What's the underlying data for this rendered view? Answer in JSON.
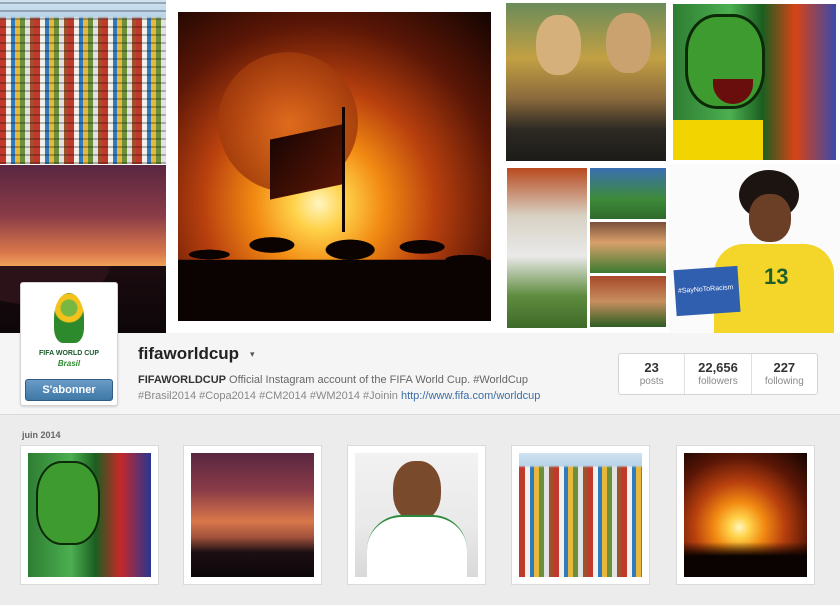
{
  "profile": {
    "username": "fifaworldcup",
    "caret": "▾",
    "follow_label": "S'abonner",
    "avatar_line1": "FIFA WORLD CUP",
    "avatar_line2": "Brasil",
    "bio_name": "FIFAWORLDCUP",
    "bio_text": " Official Instagram account of the FIFA World Cup. #WorldCup",
    "bio_tags": "#Brasil2014 #Copa2014 #CM2014 #WM2014 #Joinin ",
    "bio_link": "http://www.fifa.com/worldcup"
  },
  "stats": [
    {
      "value": "23",
      "label": "posts"
    },
    {
      "value": "22,656",
      "label": "followers"
    },
    {
      "value": "227",
      "label": "following"
    }
  ],
  "header_collage": {
    "player_number": "13",
    "sign_text": "#SayNoToRacism"
  },
  "feed": {
    "month": "juin 2014"
  }
}
